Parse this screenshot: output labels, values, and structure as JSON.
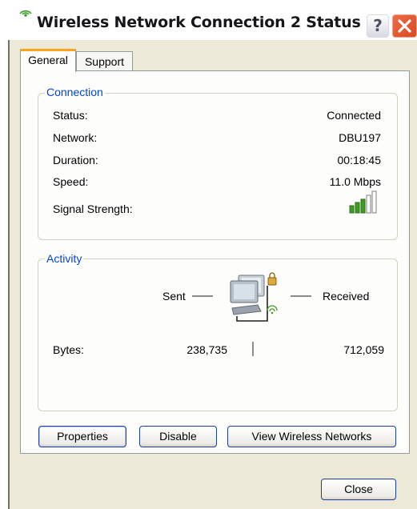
{
  "window": {
    "title": "Wireless Network Connection 2 Status"
  },
  "title_buttons": {
    "help_label": "?"
  },
  "tabs": [
    {
      "label": "General",
      "selected": true
    },
    {
      "label": "Support",
      "selected": false
    }
  ],
  "connection": {
    "legend": "Connection",
    "rows": [
      {
        "label": "Status:",
        "value": "Connected"
      },
      {
        "label": "Network:",
        "value": "DBU197"
      },
      {
        "label": "Duration:",
        "value": "00:18:45"
      },
      {
        "label": "Speed:",
        "value": "11.0 Mbps"
      }
    ],
    "signal_label": "Signal Strength:",
    "signal_bars": {
      "filled": 3,
      "total": 5
    }
  },
  "activity": {
    "legend": "Activity",
    "sent_label": "Sent",
    "received_label": "Received",
    "bytes_label": "Bytes:",
    "bytes_sent": "238,735",
    "bytes_received": "712,059"
  },
  "buttons": {
    "properties": "Properties",
    "disable": "Disable",
    "view_networks": "View Wireless Networks",
    "close": "Close"
  },
  "colors": {
    "legend_text": "#0046d5",
    "tab_highlight": "#ffa41a",
    "signal_filled": "#3f9b22",
    "signal_empty": "#ffffff"
  }
}
